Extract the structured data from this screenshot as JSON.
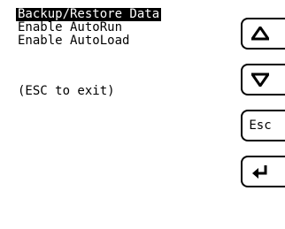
{
  "menu": {
    "items": [
      {
        "label": "Backup/Restore Data",
        "selected": true
      },
      {
        "label": "Enable AutoRun",
        "selected": false
      },
      {
        "label": "Enable AutoLoad",
        "selected": false
      }
    ],
    "hint": "(ESC to exit)"
  },
  "buttons": {
    "up": {
      "icon": "arrow-up-icon"
    },
    "down": {
      "icon": "arrow-down-icon"
    },
    "esc": {
      "label": "Esc"
    },
    "enter": {
      "icon": "enter-return-icon"
    }
  },
  "colors": {
    "background": "#ffffff",
    "foreground": "#000000",
    "selection_background": "#000000",
    "selection_text": "#ffffff"
  }
}
